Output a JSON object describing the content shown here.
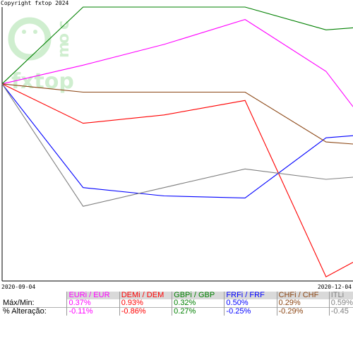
{
  "copyright": "Copyright fxtop 2024",
  "watermark": {
    "letters": [
      "c",
      "o",
      "m"
    ],
    "text": "fxtop",
    "color": "#cfeecf"
  },
  "dates": {
    "start": "2020-09-04",
    "end": "2020-12-04"
  },
  "table": {
    "row_labels": [
      "Máx/Min:",
      "% Alteração:"
    ]
  },
  "chart_data": {
    "type": "line",
    "x": [
      "2020-09-04",
      "2020-09-25",
      "2020-10-16",
      "2020-11-06",
      "2020-11-27",
      "2020-12-04"
    ],
    "xlim": [
      "2020-09-04",
      "2020-12-04"
    ],
    "ylim_percent": [
      -0.95,
      0.37
    ],
    "grid": false,
    "series": [
      {
        "name": "EURi / EUR",
        "color": "#ff00ff",
        "maxmin": "0.37%",
        "change": "-0.11%",
        "values": [
          0.0,
          0.09,
          0.19,
          0.31,
          0.06,
          -0.11
        ]
      },
      {
        "name": "DEMi / DEM",
        "color": "#ff0000",
        "maxmin": "0.93%",
        "change": "-0.86%",
        "values": [
          0.0,
          -0.19,
          -0.15,
          -0.08,
          -0.93,
          -0.86
        ]
      },
      {
        "name": "GBPi / GBP",
        "color": "#008000",
        "maxmin": "0.32%",
        "change": "0.27%",
        "values": [
          0.0,
          0.37,
          0.37,
          0.37,
          0.26,
          0.27
        ]
      },
      {
        "name": "FRFi / FRF",
        "color": "#0000ff",
        "maxmin": "0.50%",
        "change": "-0.25%",
        "values": [
          0.0,
          -0.5,
          -0.54,
          -0.55,
          -0.26,
          -0.25
        ]
      },
      {
        "name": "CHFi / CHF",
        "color": "#8b4513",
        "maxmin": "0.29%",
        "change": "-0.29%",
        "values": [
          0.0,
          -0.04,
          -0.04,
          -0.04,
          -0.28,
          -0.29
        ]
      },
      {
        "name": "ITLi",
        "color": "#808080",
        "maxmin": "0.59%",
        "change": "-0.45",
        "values": [
          0.0,
          -0.59,
          -0.5,
          -0.41,
          -0.46,
          -0.45
        ]
      }
    ]
  }
}
